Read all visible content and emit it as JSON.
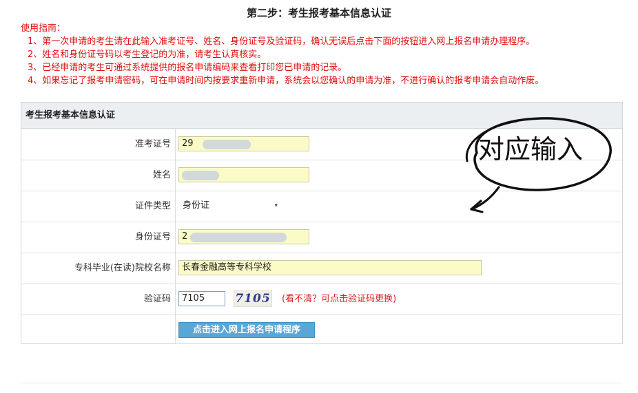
{
  "page_title": "第二步：考生报考基本信息认证",
  "guide": {
    "title": "使用指南：",
    "items": [
      "1、第一次申请的考生请在此输入准考证号、姓名、身份证号及验证码，确认无误后点击下面的按钮进入网上报名申请办理程序。",
      "2、姓名和身份证号码以考生登记的为准，请考生认真核实。",
      "3、已经申请的考生可通过系统提供的报名申请编码来查看打印您已申请的记录。",
      "4、如果忘记了报考申请密码，可在申请时间内按要求重新申请，系统会以您确认的申请为准，不进行确认的报考申请会自动作废。"
    ]
  },
  "form": {
    "header": "考生报考基本信息认证",
    "fields": {
      "exam_id_label": "准考证号",
      "exam_id_value": "29",
      "name_label": "姓名",
      "name_value": "",
      "id_type_label": "证件类型",
      "id_type_value": "身份证",
      "id_number_label": "身份证号",
      "id_number_value": "2",
      "school_label": "专科毕业(在读)院校名称",
      "school_value": "长春金融高等专科学校",
      "captcha_label": "验证码",
      "captcha_value": "7105",
      "captcha_image_text": "7105",
      "captcha_hint": "(看不清？可点击验证码更换)"
    },
    "submit_label": "点击进入网上报名申请程序"
  },
  "annotation": {
    "text": "对应输入"
  },
  "colors": {
    "guide_text": "#e01010",
    "input_highlight": "#fbfbc8",
    "button": "#5aa7d6",
    "header_bg": "#eceff2"
  }
}
